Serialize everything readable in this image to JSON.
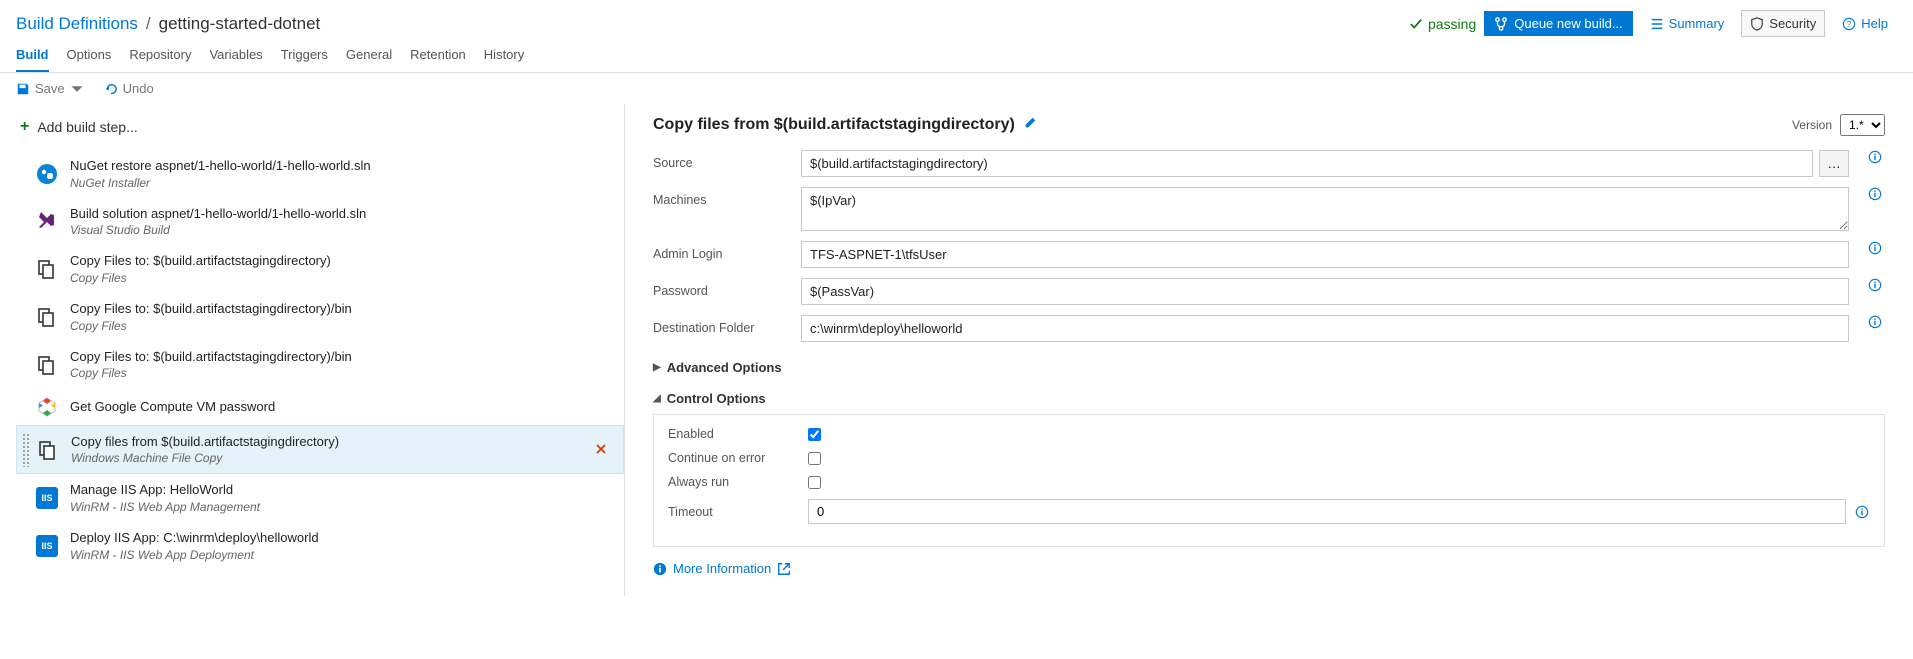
{
  "breadcrumb": {
    "root": "Build Definitions",
    "sep": "/",
    "current": "getting-started-dotnet"
  },
  "status": {
    "text": "passing"
  },
  "header_buttons": {
    "queue": "Queue new build...",
    "summary": "Summary",
    "security": "Security",
    "help": "Help"
  },
  "tabs": [
    "Build",
    "Options",
    "Repository",
    "Variables",
    "Triggers",
    "General",
    "Retention",
    "History"
  ],
  "active_tab": "Build",
  "toolbar": {
    "save": "Save",
    "undo": "Undo"
  },
  "add_step": "Add build step...",
  "steps": [
    {
      "icon": "nuget",
      "title": "NuGet restore aspnet/1-hello-world/1-hello-world.sln",
      "sub": "NuGet Installer"
    },
    {
      "icon": "vs",
      "title": "Build solution aspnet/1-hello-world/1-hello-world.sln",
      "sub": "Visual Studio Build"
    },
    {
      "icon": "copy",
      "title": "Copy Files to: $(build.artifactstagingdirectory)",
      "sub": "Copy Files"
    },
    {
      "icon": "copy",
      "title": "Copy Files to: $(build.artifactstagingdirectory)/bin",
      "sub": "Copy Files"
    },
    {
      "icon": "copy",
      "title": "Copy Files to: $(build.artifactstagingdirectory)/bin",
      "sub": "Copy Files"
    },
    {
      "icon": "gce",
      "title": "Get Google Compute VM password",
      "sub": ""
    },
    {
      "icon": "copy",
      "title": "Copy files from $(build.artifactstagingdirectory)",
      "sub": "Windows Machine File Copy",
      "selected": true
    },
    {
      "icon": "iis",
      "title": "Manage IIS App: HelloWorld",
      "sub": "WinRM - IIS Web App Management"
    },
    {
      "icon": "iis",
      "title": "Deploy IIS App: C:\\winrm\\deploy\\helloworld",
      "sub": "WinRM - IIS Web App Deployment"
    }
  ],
  "panel": {
    "title": "Copy files from $(build.artifactstagingdirectory)",
    "version_label": "Version",
    "version_value": "1.*",
    "fields": {
      "source": {
        "label": "Source",
        "value": "$(build.artifactstagingdirectory)"
      },
      "machines": {
        "label": "Machines",
        "value": "$(IpVar)"
      },
      "admin_login": {
        "label": "Admin Login",
        "value": "TFS-ASPNET-1\\tfsUser"
      },
      "password": {
        "label": "Password",
        "value": "$(PassVar)"
      },
      "dest": {
        "label": "Destination Folder",
        "value": "c:\\winrm\\deploy\\helloworld"
      }
    },
    "sections": {
      "advanced": "Advanced Options",
      "control": "Control Options"
    },
    "control": {
      "enabled": {
        "label": "Enabled",
        "checked": true
      },
      "cont_err": {
        "label": "Continue on error",
        "checked": false
      },
      "always": {
        "label": "Always run",
        "checked": false
      },
      "timeout": {
        "label": "Timeout",
        "value": "0"
      }
    },
    "more_info": "More Information"
  }
}
